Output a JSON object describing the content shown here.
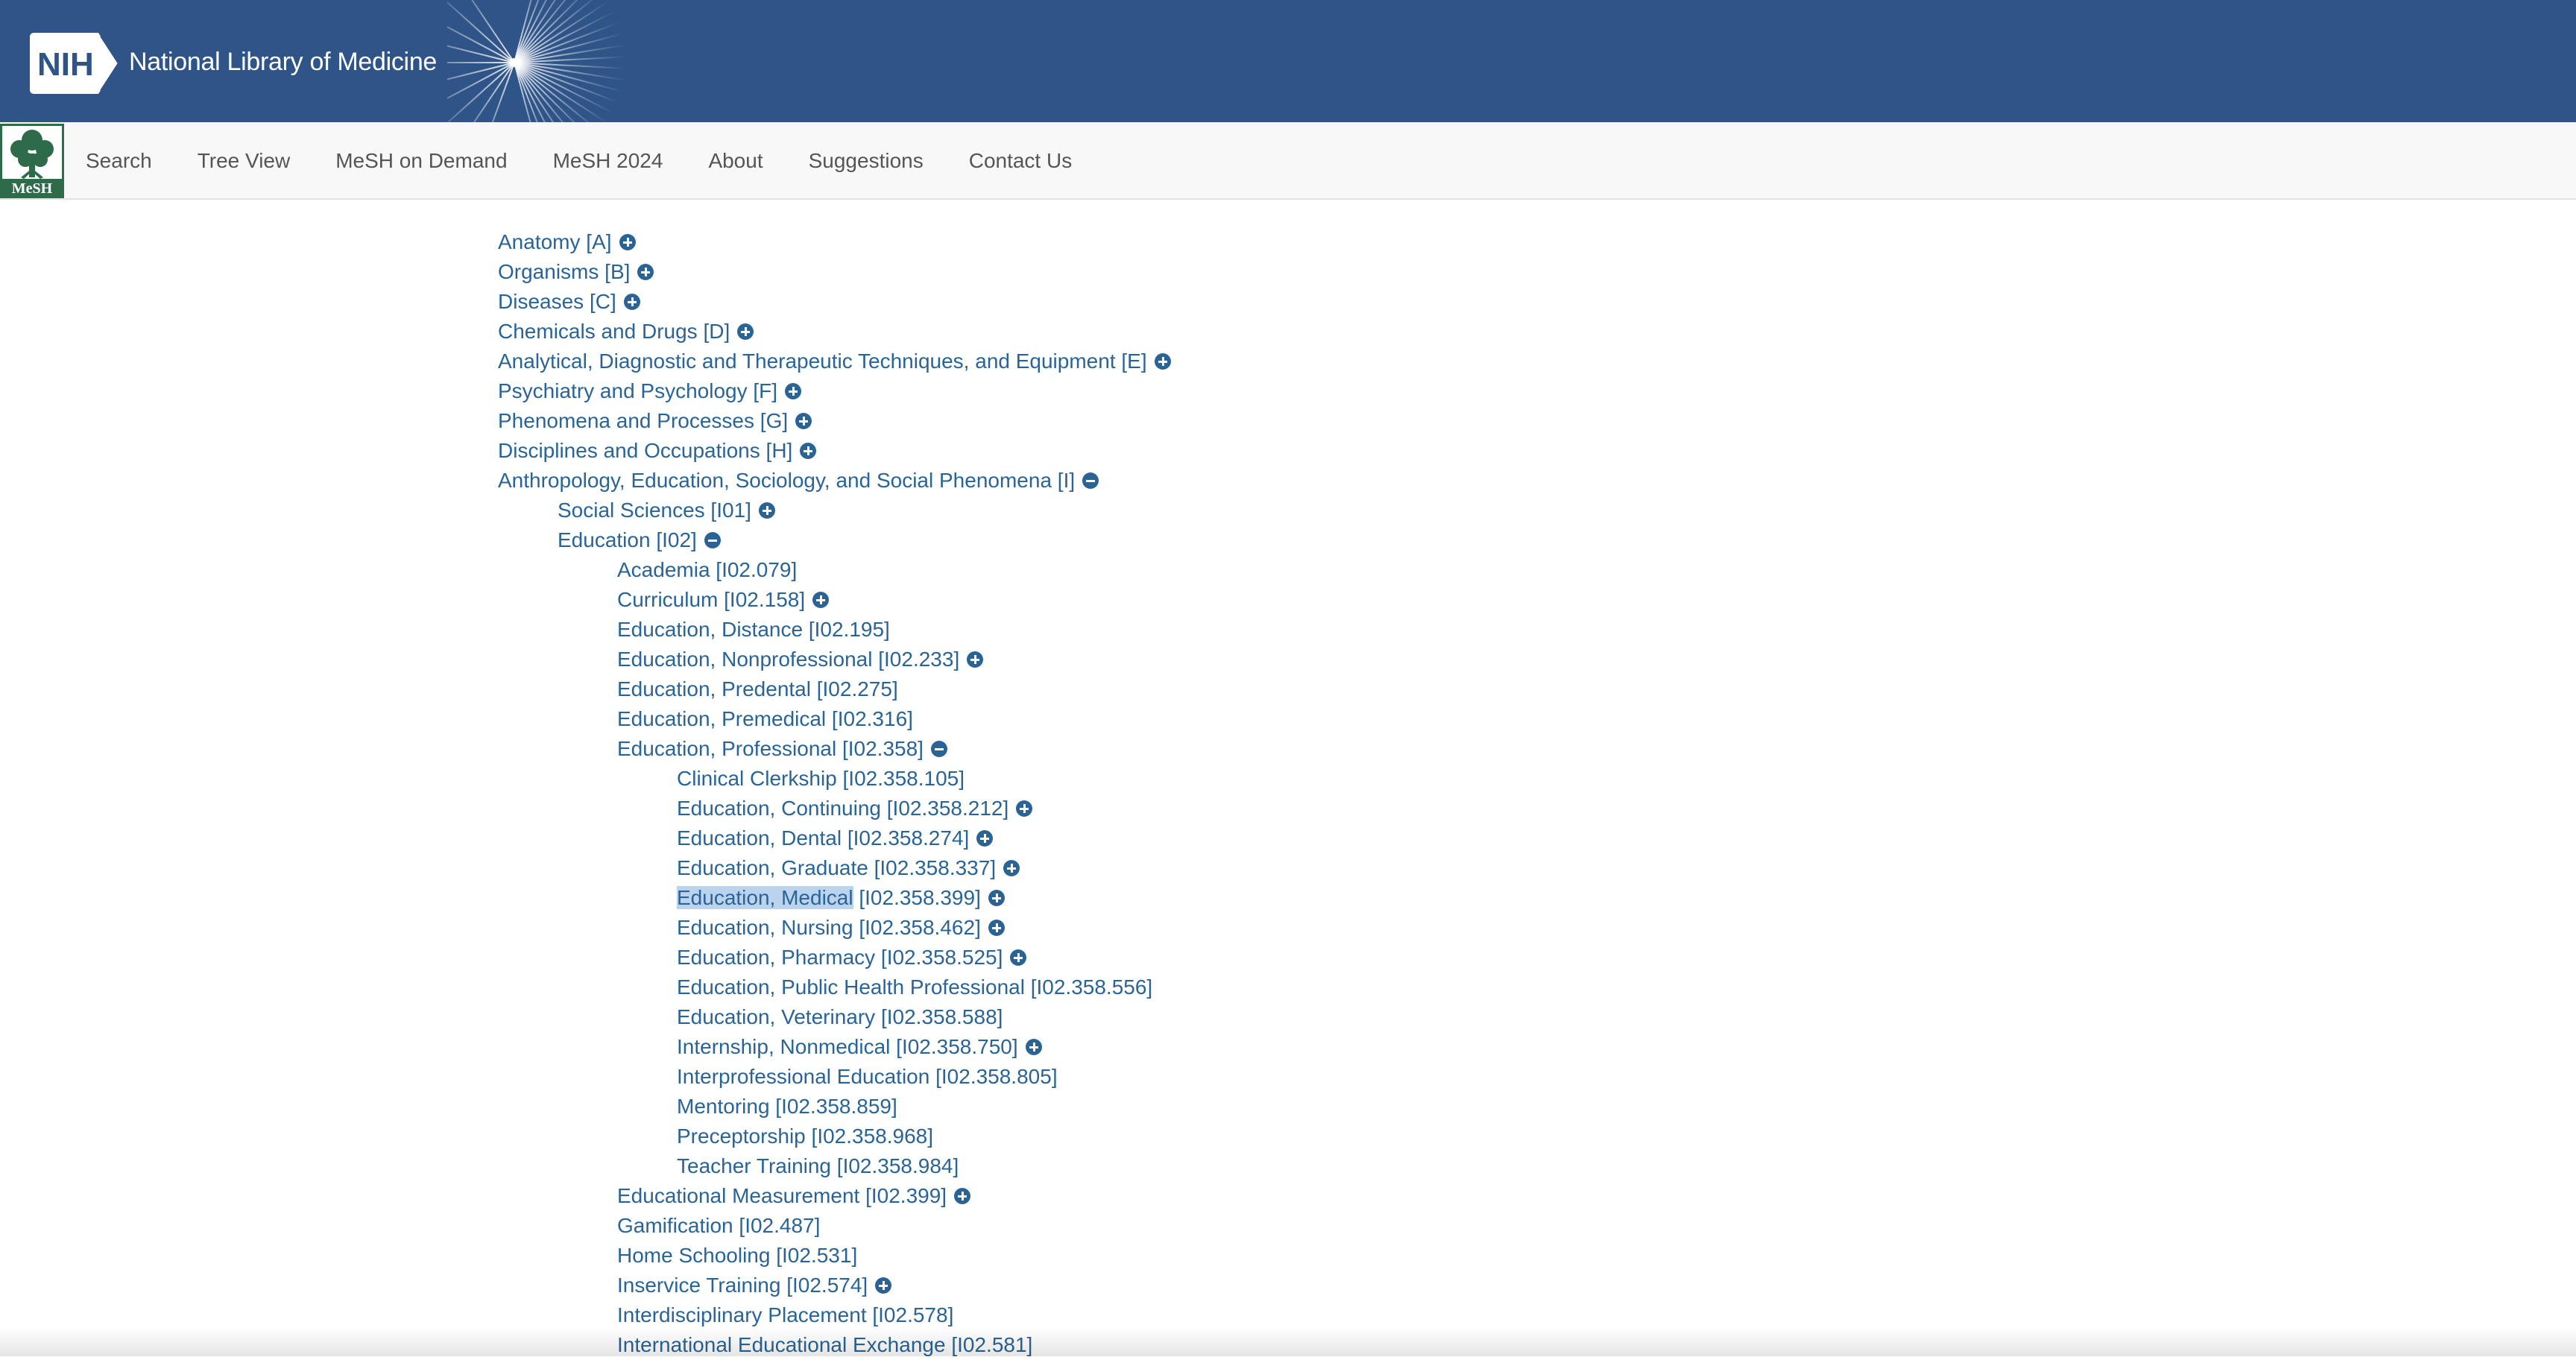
{
  "banner": {
    "logo_text": "NIH",
    "title": "National Library of Medicine"
  },
  "nav": {
    "logo_text": "MeSH",
    "items": [
      {
        "label": "Search"
      },
      {
        "label": "Tree View"
      },
      {
        "label": "MeSH on Demand"
      },
      {
        "label": "MeSH 2024"
      },
      {
        "label": "About"
      },
      {
        "label": "Suggestions"
      },
      {
        "label": "Contact Us"
      }
    ]
  },
  "tree": [
    {
      "level": 0,
      "name": "Anatomy",
      "code": "A",
      "toggle": "expand"
    },
    {
      "level": 0,
      "name": "Organisms",
      "code": "B",
      "toggle": "expand"
    },
    {
      "level": 0,
      "name": "Diseases",
      "code": "C",
      "toggle": "expand"
    },
    {
      "level": 0,
      "name": "Chemicals and Drugs",
      "code": "D",
      "toggle": "expand"
    },
    {
      "level": 0,
      "name": "Analytical, Diagnostic and Therapeutic Techniques, and Equipment",
      "code": "E",
      "toggle": "expand"
    },
    {
      "level": 0,
      "name": "Psychiatry and Psychology",
      "code": "F",
      "toggle": "expand"
    },
    {
      "level": 0,
      "name": "Phenomena and Processes",
      "code": "G",
      "toggle": "expand"
    },
    {
      "level": 0,
      "name": "Disciplines and Occupations",
      "code": "H",
      "toggle": "expand"
    },
    {
      "level": 0,
      "name": "Anthropology, Education, Sociology, and Social Phenomena",
      "code": "I",
      "toggle": "collapse"
    },
    {
      "level": 1,
      "name": "Social Sciences",
      "code": "I01",
      "toggle": "expand"
    },
    {
      "level": 1,
      "name": "Education",
      "code": "I02",
      "toggle": "collapse"
    },
    {
      "level": 2,
      "name": "Academia",
      "code": "I02.079",
      "toggle": ""
    },
    {
      "level": 2,
      "name": "Curriculum",
      "code": "I02.158",
      "toggle": "expand"
    },
    {
      "level": 2,
      "name": "Education, Distance",
      "code": "I02.195",
      "toggle": ""
    },
    {
      "level": 2,
      "name": "Education, Nonprofessional",
      "code": "I02.233",
      "toggle": "expand"
    },
    {
      "level": 2,
      "name": "Education, Predental",
      "code": "I02.275",
      "toggle": ""
    },
    {
      "level": 2,
      "name": "Education, Premedical",
      "code": "I02.316",
      "toggle": ""
    },
    {
      "level": 2,
      "name": "Education, Professional",
      "code": "I02.358",
      "toggle": "collapse"
    },
    {
      "level": 3,
      "name": "Clinical Clerkship",
      "code": "I02.358.105",
      "toggle": ""
    },
    {
      "level": 3,
      "name": "Education, Continuing",
      "code": "I02.358.212",
      "toggle": "expand"
    },
    {
      "level": 3,
      "name": "Education, Dental",
      "code": "I02.358.274",
      "toggle": "expand"
    },
    {
      "level": 3,
      "name": "Education, Graduate",
      "code": "I02.358.337",
      "toggle": "expand"
    },
    {
      "level": 3,
      "name": "Education, Medical",
      "code": "I02.358.399",
      "toggle": "expand",
      "selected": true
    },
    {
      "level": 3,
      "name": "Education, Nursing",
      "code": "I02.358.462",
      "toggle": "expand"
    },
    {
      "level": 3,
      "name": "Education, Pharmacy",
      "code": "I02.358.525",
      "toggle": "expand"
    },
    {
      "level": 3,
      "name": "Education, Public Health Professional",
      "code": "I02.358.556",
      "toggle": ""
    },
    {
      "level": 3,
      "name": "Education, Veterinary",
      "code": "I02.358.588",
      "toggle": ""
    },
    {
      "level": 3,
      "name": "Internship, Nonmedical",
      "code": "I02.358.750",
      "toggle": "expand"
    },
    {
      "level": 3,
      "name": "Interprofessional Education",
      "code": "I02.358.805",
      "toggle": ""
    },
    {
      "level": 3,
      "name": "Mentoring",
      "code": "I02.358.859",
      "toggle": ""
    },
    {
      "level": 3,
      "name": "Preceptorship",
      "code": "I02.358.968",
      "toggle": ""
    },
    {
      "level": 3,
      "name": "Teacher Training",
      "code": "I02.358.984",
      "toggle": ""
    },
    {
      "level": 2,
      "name": "Educational Measurement",
      "code": "I02.399",
      "toggle": "expand"
    },
    {
      "level": 2,
      "name": "Gamification",
      "code": "I02.487",
      "toggle": ""
    },
    {
      "level": 2,
      "name": "Home Schooling",
      "code": "I02.531",
      "toggle": ""
    },
    {
      "level": 2,
      "name": "Inservice Training",
      "code": "I02.574",
      "toggle": "expand"
    },
    {
      "level": 2,
      "name": "Interdisciplinary Placement",
      "code": "I02.578",
      "toggle": ""
    },
    {
      "level": 2,
      "name": "International Educational Exchange",
      "code": "I02.581",
      "toggle": ""
    }
  ],
  "colors": {
    "banner": "#2f5487",
    "link": "#2a6496",
    "selection": "#bcd3ee",
    "nav_text": "#555555",
    "mesh_green": "#2e6b4a"
  }
}
